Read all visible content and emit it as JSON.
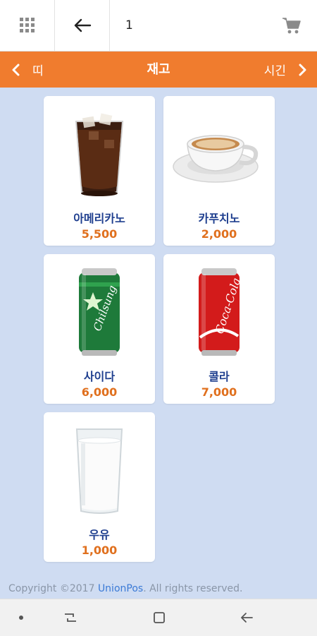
{
  "header": {
    "cart_count": "1"
  },
  "category_bar": {
    "prev_label": "띠",
    "title": "재고",
    "next_label": "시긴"
  },
  "products": [
    {
      "name": "아메리카노",
      "price": "5,500",
      "icon": "iced-americano-image"
    },
    {
      "name": "카푸치노",
      "price": "2,000",
      "icon": "cappuccino-image"
    },
    {
      "name": "사이다",
      "price": "6,000",
      "icon": "cider-can-image"
    },
    {
      "name": "콜라",
      "price": "7,000",
      "icon": "cola-can-image"
    },
    {
      "name": "우유",
      "price": "1,000",
      "icon": "milk-glass-image"
    }
  ],
  "footer": {
    "prefix": "Copyright ©2017 ",
    "brand": "UnionPos",
    "suffix": ". All rights reserved."
  },
  "colors": {
    "accent": "#f07c2e",
    "background": "#cfdcf2",
    "name_text": "#1f3f8f",
    "price_text": "#e0701e"
  }
}
